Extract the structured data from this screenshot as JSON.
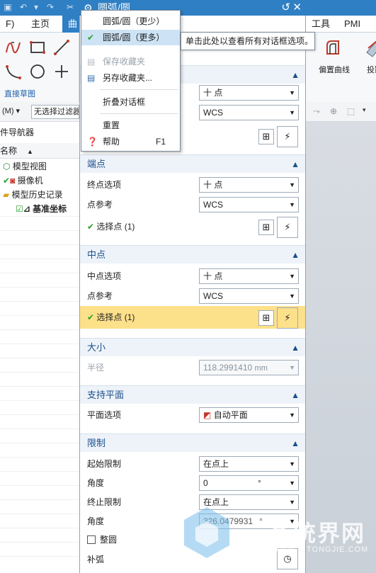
{
  "ribbon": {
    "tabs": [
      {
        "label": "F)"
      },
      {
        "label": "主页"
      },
      {
        "label": "曲"
      },
      {
        "label": "工具"
      },
      {
        "label": "PMI"
      }
    ],
    "group_label": "直接草图",
    "right_buttons": [
      {
        "label": "偏置曲线"
      },
      {
        "label": "投影曲"
      }
    ]
  },
  "filter": {
    "mode_label": "(M)",
    "filter_value": "无选择过滤器"
  },
  "navigator": {
    "title": "部件导航器",
    "column_header": "名称",
    "items": [
      {
        "label": "模型视图"
      },
      {
        "label": "摄像机"
      },
      {
        "label": "模型历史记录"
      },
      {
        "label": "基准坐标"
      }
    ]
  },
  "dialog": {
    "title": "圆弧/圆",
    "sections": {
      "endpoint": {
        "title": "端点",
        "option_label": "终点选项",
        "option_value": "十 点",
        "ref_label": "点参考",
        "ref_value": "WCS",
        "select_label": "选择点 (1)"
      },
      "midpoint": {
        "title": "中点",
        "option_label": "中点选项",
        "option_value": "十 点",
        "ref_label": "点参考",
        "ref_value": "WCS",
        "select_label": "选择点 (1)"
      },
      "size": {
        "title": "大小",
        "radius_label": "半径",
        "radius_value": "118.2991410",
        "radius_unit": "mm"
      },
      "plane": {
        "title": "支持平面",
        "option_label": "平面选项",
        "option_value": "自动平面"
      },
      "limits": {
        "title": "限制",
        "start_label": "起始限制",
        "start_value": "在点上",
        "start_angle_label": "角度",
        "start_angle_value": "0",
        "end_label": "终止限制",
        "end_value": "在点上",
        "end_angle_label": "角度",
        "end_angle_value": "326.0479931",
        "angle_unit": "°",
        "full_circle_label": "整圆",
        "complement_label": "补弧"
      },
      "top": {
        "option_value": "十 点",
        "ref_value": "WCS"
      }
    }
  },
  "menu": {
    "items": [
      {
        "label": "圆弧/圆（更少）"
      },
      {
        "label": "圆弧/圆（更多）"
      },
      {
        "label": "保存收藏夹"
      },
      {
        "label": "另存收藏夹..."
      },
      {
        "label": "折叠对话框"
      },
      {
        "label": "重置"
      },
      {
        "label": "帮助",
        "shortcut": "F1"
      }
    ],
    "tooltip": "单击此处以查看所有对话框选项。"
  },
  "watermark": {
    "text": "系统界网",
    "sub": "WWW.XITONGJIE.COM"
  },
  "colors": {
    "title_bar": "#2f7fc4",
    "highlight_row": "#fde08a",
    "menu_selected": "#cde3f5",
    "check_green": "#2aa02a"
  }
}
